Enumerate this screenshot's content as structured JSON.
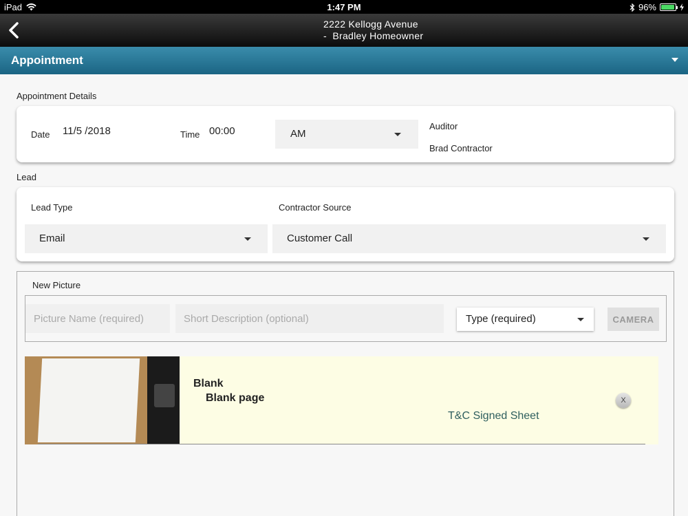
{
  "status_bar": {
    "device": "iPad",
    "time": "1:47 PM",
    "battery": "96%",
    "battery_level": 0.96
  },
  "nav": {
    "address": "2222 Kellogg Avenue",
    "customer": "-  Bradley Homeowner",
    "back_icon": "chevron-left-icon"
  },
  "section": {
    "title": "Appointment"
  },
  "appointment_details": {
    "label": "Appointment Details",
    "date_label": "Date",
    "date_value": "11/5 /2018",
    "time_label": "Time",
    "time_value": "00:00",
    "ampm_value": "AM",
    "auditor_label": "Auditor",
    "auditor_value": "Brad Contractor"
  },
  "lead": {
    "label": "Lead",
    "lead_type_label": "Lead Type",
    "lead_type_value": "Email",
    "contractor_source_label": "Contractor Source",
    "contractor_source_value": "Customer Call"
  },
  "new_picture": {
    "label": "New Picture",
    "name_placeholder": "Picture Name (required)",
    "description_placeholder": "Short Description (optional)",
    "type_value": "Type (required)",
    "camera_label": "CAMERA"
  },
  "pictures": [
    {
      "name": "Blank",
      "description": "Blank page",
      "type": "T&C Signed Sheet",
      "remove_label": "X"
    }
  ],
  "colors": {
    "header_accent": "#2a7a9a",
    "photo_background": "#fdfde4",
    "battery_green": "#4cd964"
  }
}
